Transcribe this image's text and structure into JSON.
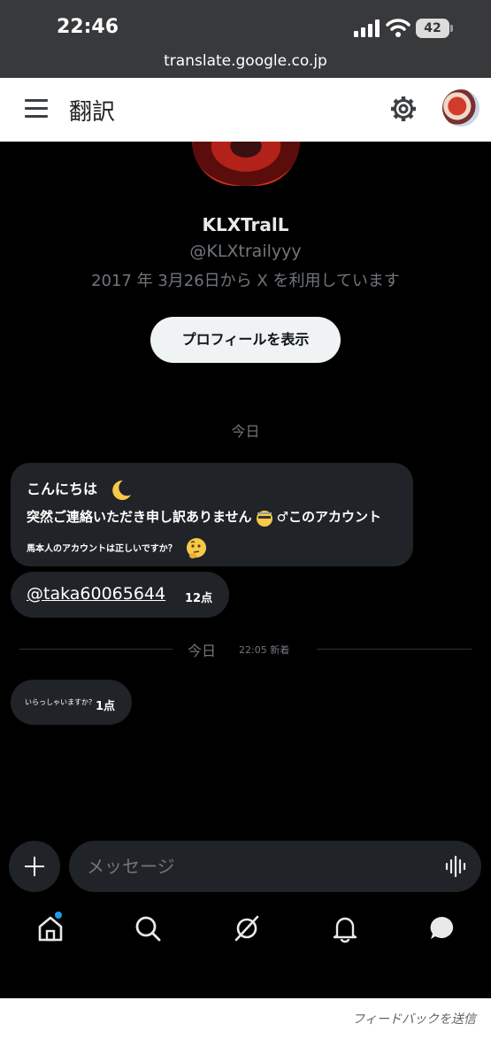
{
  "status_bar": {
    "time": "22:46",
    "battery": "42"
  },
  "browser": {
    "url": "translate.google.co.jp"
  },
  "translate_header": {
    "title": "翻訳"
  },
  "profile": {
    "name": "KLXTralL",
    "handle": "@KLXtrailyyy",
    "since": "2017 年 3月26日から X を利用しています",
    "view_profile_label": "プロフィールを表示"
  },
  "conversation": {
    "date_label": "今日",
    "message1": {
      "line1": "こんにちは",
      "line2_a": "突然ご連絡いただき申し訳ありません",
      "line2_b": "このアカウント",
      "line3": "馬本人のアカウントは正しいですか？"
    },
    "message2": {
      "link": "@taka60065644",
      "points": "12点"
    },
    "divider": {
      "date": "今日",
      "new_label": "22:05 新着"
    },
    "message3": {
      "text": "いらっしゃいますか？",
      "points": "1点"
    }
  },
  "composer": {
    "placeholder": "メッセージ"
  },
  "bottom_nav": {
    "items": [
      "home-icon",
      "search-icon",
      "grok-icon",
      "bell-icon",
      "messages-icon"
    ],
    "accent": "#1d9bf0"
  },
  "footer": {
    "feedback": "フィードバックを送信"
  }
}
